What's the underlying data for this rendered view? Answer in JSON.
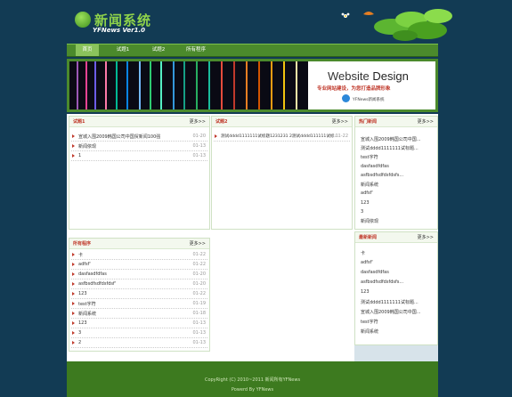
{
  "header": {
    "logo_text": "新闻系统",
    "logo_sub": "YFNews Ver1.0"
  },
  "nav": [
    {
      "label": "首页",
      "active": true
    },
    {
      "label": "试题1",
      "active": false
    },
    {
      "label": "试题2",
      "active": false
    },
    {
      "label": "所有程序",
      "active": false
    }
  ],
  "banner": {
    "title_a": "Website",
    "title_b": "Design",
    "subtitle": "专业网站建设，为您打造品牌形象",
    "small": "YFNews新闻系统"
  },
  "panel1": {
    "title": "试题1",
    "more": "更多>>",
    "rows": [
      {
        "t": "宣城入围2009韩国公司中国贸新闻100强",
        "d": "01-20"
      },
      {
        "t": "新闻依现",
        "d": "01-13"
      },
      {
        "t": "1",
        "d": "01-13"
      }
    ]
  },
  "panel2": {
    "title": "试题2",
    "more": "更多>>",
    "rows": [
      {
        "t": "测试dddd1111111试标题1231231 2测试dddd111111试标...",
        "d": "01-22"
      }
    ]
  },
  "panel3": {
    "title": "所有程序",
    "more": "更多>>",
    "rows": [
      {
        "t": "卡",
        "d": "01-22"
      },
      {
        "t": "adfsf'",
        "d": "01-22"
      },
      {
        "t": "dasfasdfdfas",
        "d": "01-20"
      },
      {
        "t": "asfbsdfsdfdsfdsf'",
        "d": "01-20"
      },
      {
        "t": "123",
        "d": "01-22"
      },
      {
        "t": "test字符",
        "d": "01-19"
      },
      {
        "t": "新闻系统",
        "d": "01-18"
      },
      {
        "t": "123",
        "d": "01-13"
      },
      {
        "t": "3",
        "d": "01-13"
      },
      {
        "t": "2",
        "d": "01-13"
      }
    ]
  },
  "hot": {
    "title": "热门新闻",
    "more": "更多>>",
    "items": [
      "宣城入围2009韩国公司中国...",
      "测试dddd1111111试标题...",
      "test字符",
      "dasfasdfdfas",
      "asfbsdfsdfdsfdsfs...",
      "新闻系统",
      "adfsf'",
      "123",
      "3",
      "新闻依现"
    ]
  },
  "latest": {
    "title": "最新新闻",
    "more": "更多>>",
    "items": [
      "卡",
      "adfsf'",
      "dasfasdfdfas",
      "asfbsdfsdfdsfdsfs...",
      "123",
      "测试dddd1111111试标题...",
      "宣城入围2009韩国公司中国...",
      "test字符",
      "新闻系统"
    ]
  },
  "footer": {
    "copyright": "CopyRight (C) 2010~2011 新闻所有YFNews",
    "powered": "Powerd By YFNews"
  }
}
